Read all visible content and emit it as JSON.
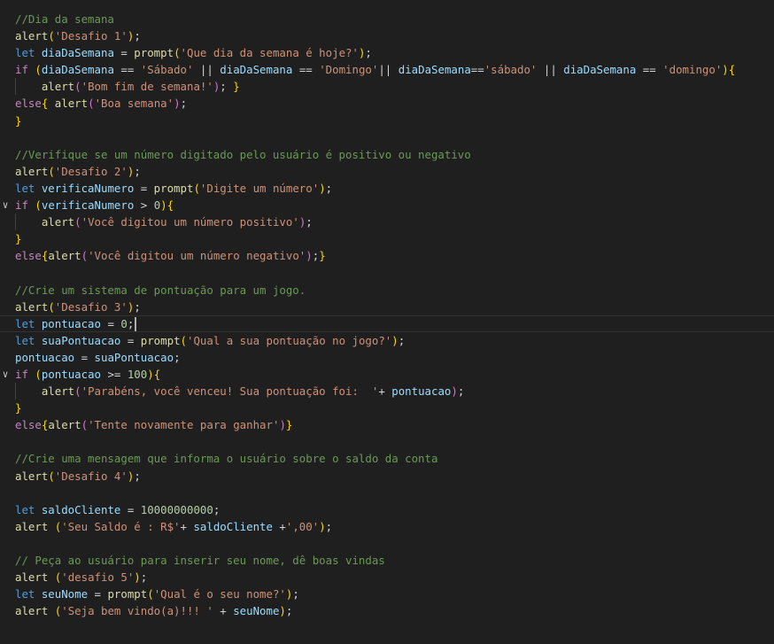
{
  "colors": {
    "background": "#1f1f1f",
    "comment": "#6a9955",
    "keyword": "#569cd6",
    "control": "#c586c0",
    "function": "#dcdcaa",
    "variable": "#9cdcfe",
    "string": "#ce9178",
    "number": "#b5cea8",
    "bracket1": "#ffd700",
    "bracket2": "#da70d6"
  },
  "editor": {
    "cursor_line": 19,
    "lines": [
      {
        "tokens": [
          [
            "c",
            "//Dia da semana"
          ]
        ]
      },
      {
        "tokens": [
          [
            "f",
            "alert"
          ],
          [
            "b1",
            "("
          ],
          [
            "s",
            "'Desafio 1'"
          ],
          [
            "b1",
            ")"
          ],
          [
            "o",
            ";"
          ]
        ]
      },
      {
        "tokens": [
          [
            "k",
            "let "
          ],
          [
            "v",
            "diaDaSemana"
          ],
          [
            "o",
            " = "
          ],
          [
            "f",
            "prompt"
          ],
          [
            "b1",
            "("
          ],
          [
            "s",
            "'Que dia da semana é hoje?'"
          ],
          [
            "b1",
            ")"
          ],
          [
            "o",
            ";"
          ]
        ]
      },
      {
        "tokens": [
          [
            "ctl",
            "if "
          ],
          [
            "b1",
            "("
          ],
          [
            "v",
            "diaDaSemana"
          ],
          [
            "o",
            " == "
          ],
          [
            "s",
            "'Sábado'"
          ],
          [
            "o",
            " || "
          ],
          [
            "v",
            "diaDaSemana"
          ],
          [
            "o",
            " == "
          ],
          [
            "s",
            "'Domingo'"
          ],
          [
            "o",
            "|| "
          ],
          [
            "v",
            "diaDaSemana"
          ],
          [
            "o",
            "=="
          ],
          [
            "s",
            "'sábado'"
          ],
          [
            "o",
            " || "
          ],
          [
            "v",
            "diaDaSemana"
          ],
          [
            "o",
            " == "
          ],
          [
            "s",
            "'domingo'"
          ],
          [
            "b1",
            ")"
          ],
          [
            "b1",
            "{"
          ]
        ]
      },
      {
        "guide": true,
        "tokens": [
          [
            "o",
            "    "
          ],
          [
            "f",
            "alert"
          ],
          [
            "b2",
            "("
          ],
          [
            "s",
            "'Bom fim de semana!'"
          ],
          [
            "b2",
            ")"
          ],
          [
            "o",
            "; "
          ],
          [
            "b1",
            "}"
          ]
        ]
      },
      {
        "tokens": [
          [
            "ctl",
            "else"
          ],
          [
            "b1",
            "{"
          ],
          [
            "o",
            " "
          ],
          [
            "f",
            "alert"
          ],
          [
            "b2",
            "("
          ],
          [
            "s",
            "'Boa semana'"
          ],
          [
            "b2",
            ")"
          ],
          [
            "o",
            ";"
          ]
        ]
      },
      {
        "tokens": [
          [
            "b1",
            "}"
          ]
        ]
      },
      {
        "tokens": []
      },
      {
        "tokens": [
          [
            "c",
            "//Verifique se um número digitado pelo usuário é positivo ou negativo"
          ]
        ]
      },
      {
        "tokens": [
          [
            "f",
            "alert"
          ],
          [
            "b1",
            "("
          ],
          [
            "s",
            "'Desafio 2'"
          ],
          [
            "b1",
            ")"
          ],
          [
            "o",
            ";"
          ]
        ]
      },
      {
        "tokens": [
          [
            "k",
            "let "
          ],
          [
            "v",
            "verificaNumero"
          ],
          [
            "o",
            " = "
          ],
          [
            "f",
            "prompt"
          ],
          [
            "b1",
            "("
          ],
          [
            "s",
            "'Digite um número'"
          ],
          [
            "b1",
            ")"
          ],
          [
            "o",
            ";"
          ]
        ]
      },
      {
        "fold": true,
        "tokens": [
          [
            "ctl",
            "if "
          ],
          [
            "b1",
            "("
          ],
          [
            "v",
            "verificaNumero"
          ],
          [
            "o",
            " > "
          ],
          [
            "n",
            "0"
          ],
          [
            "b1",
            ")"
          ],
          [
            "b1",
            "{"
          ]
        ]
      },
      {
        "guide": true,
        "tokens": [
          [
            "o",
            "    "
          ],
          [
            "f",
            "alert"
          ],
          [
            "b2",
            "("
          ],
          [
            "s",
            "'Você digitou um número positivo'"
          ],
          [
            "b2",
            ")"
          ],
          [
            "o",
            ";"
          ]
        ]
      },
      {
        "tokens": [
          [
            "b1",
            "}"
          ]
        ]
      },
      {
        "tokens": [
          [
            "ctl",
            "else"
          ],
          [
            "b1",
            "{"
          ],
          [
            "f",
            "alert"
          ],
          [
            "b2",
            "("
          ],
          [
            "s",
            "'Você digitou um número negativo'"
          ],
          [
            "b2",
            ")"
          ],
          [
            "o",
            ";"
          ],
          [
            "b1",
            "}"
          ]
        ]
      },
      {
        "tokens": []
      },
      {
        "tokens": [
          [
            "c",
            "//Crie um sistema de pontuação para um jogo."
          ]
        ]
      },
      {
        "tokens": [
          [
            "f",
            "alert"
          ],
          [
            "b1",
            "("
          ],
          [
            "s",
            "'Desafio 3'"
          ],
          [
            "b1",
            ")"
          ],
          [
            "o",
            ";"
          ]
        ]
      },
      {
        "tokens": [
          [
            "k",
            "let "
          ],
          [
            "v",
            "pontuacao"
          ],
          [
            "o",
            " = "
          ],
          [
            "n",
            "0"
          ],
          [
            "o",
            ";"
          ]
        ]
      },
      {
        "tokens": [
          [
            "k",
            "let "
          ],
          [
            "v",
            "suaPontuacao"
          ],
          [
            "o",
            " = "
          ],
          [
            "f",
            "prompt"
          ],
          [
            "b1",
            "("
          ],
          [
            "s",
            "'Qual a sua pontuação no jogo?'"
          ],
          [
            "b1",
            ")"
          ],
          [
            "o",
            ";"
          ]
        ]
      },
      {
        "tokens": [
          [
            "v",
            "pontuacao"
          ],
          [
            "o",
            " = "
          ],
          [
            "v",
            "suaPontuacao"
          ],
          [
            "o",
            ";"
          ]
        ]
      },
      {
        "fold": true,
        "tokens": [
          [
            "ctl",
            "if "
          ],
          [
            "b1",
            "("
          ],
          [
            "v",
            "pontuacao"
          ],
          [
            "o",
            " >= "
          ],
          [
            "n",
            "100"
          ],
          [
            "b1",
            ")"
          ],
          [
            "b1",
            "{"
          ]
        ]
      },
      {
        "guide": true,
        "tokens": [
          [
            "o",
            "    "
          ],
          [
            "f",
            "alert"
          ],
          [
            "b2",
            "("
          ],
          [
            "s",
            "'Parabéns, você venceu! Sua pontuação foi:  '"
          ],
          [
            "o",
            "+ "
          ],
          [
            "v",
            "pontuacao"
          ],
          [
            "b2",
            ")"
          ],
          [
            "o",
            ";"
          ]
        ]
      },
      {
        "tokens": [
          [
            "b1",
            "}"
          ]
        ]
      },
      {
        "tokens": [
          [
            "ctl",
            "else"
          ],
          [
            "b1",
            "{"
          ],
          [
            "f",
            "alert"
          ],
          [
            "b2",
            "("
          ],
          [
            "s",
            "'Tente novamente para ganhar'"
          ],
          [
            "b2",
            ")"
          ],
          [
            "b1",
            "}"
          ]
        ]
      },
      {
        "tokens": []
      },
      {
        "tokens": [
          [
            "c",
            "//Crie uma mensagem que informa o usuário sobre o saldo da conta"
          ]
        ]
      },
      {
        "tokens": [
          [
            "f",
            "alert"
          ],
          [
            "b1",
            "("
          ],
          [
            "s",
            "'Desafio 4'"
          ],
          [
            "b1",
            ")"
          ],
          [
            "o",
            ";"
          ]
        ]
      },
      {
        "tokens": []
      },
      {
        "tokens": [
          [
            "k",
            "let "
          ],
          [
            "v",
            "saldoCliente"
          ],
          [
            "o",
            " = "
          ],
          [
            "n",
            "10000000000"
          ],
          [
            "o",
            ";"
          ]
        ]
      },
      {
        "tokens": [
          [
            "f",
            "alert "
          ],
          [
            "b1",
            "("
          ],
          [
            "s",
            "'Seu Saldo é : R$'"
          ],
          [
            "o",
            "+ "
          ],
          [
            "v",
            "saldoCliente"
          ],
          [
            "o",
            " +"
          ],
          [
            "s",
            "',00'"
          ],
          [
            "b1",
            ")"
          ],
          [
            "o",
            ";"
          ]
        ]
      },
      {
        "tokens": []
      },
      {
        "tokens": [
          [
            "c",
            "// Peça ao usuário para inserir seu nome, dê boas vindas"
          ]
        ]
      },
      {
        "tokens": [
          [
            "f",
            "alert "
          ],
          [
            "b1",
            "("
          ],
          [
            "s",
            "'desafio 5'"
          ],
          [
            "b1",
            ")"
          ],
          [
            "o",
            ";"
          ]
        ]
      },
      {
        "tokens": [
          [
            "k",
            "let "
          ],
          [
            "v",
            "seuNome"
          ],
          [
            "o",
            " = "
          ],
          [
            "f",
            "prompt"
          ],
          [
            "b1",
            "("
          ],
          [
            "s",
            "'Qual é o seu nome?'"
          ],
          [
            "b1",
            ")"
          ],
          [
            "o",
            ";"
          ]
        ]
      },
      {
        "tokens": [
          [
            "f",
            "alert "
          ],
          [
            "b1",
            "("
          ],
          [
            "s",
            "'Seja bem vindo(a)!!! '"
          ],
          [
            "o",
            " + "
          ],
          [
            "v",
            "seuNome"
          ],
          [
            "b1",
            ")"
          ],
          [
            "o",
            ";"
          ]
        ]
      }
    ]
  }
}
